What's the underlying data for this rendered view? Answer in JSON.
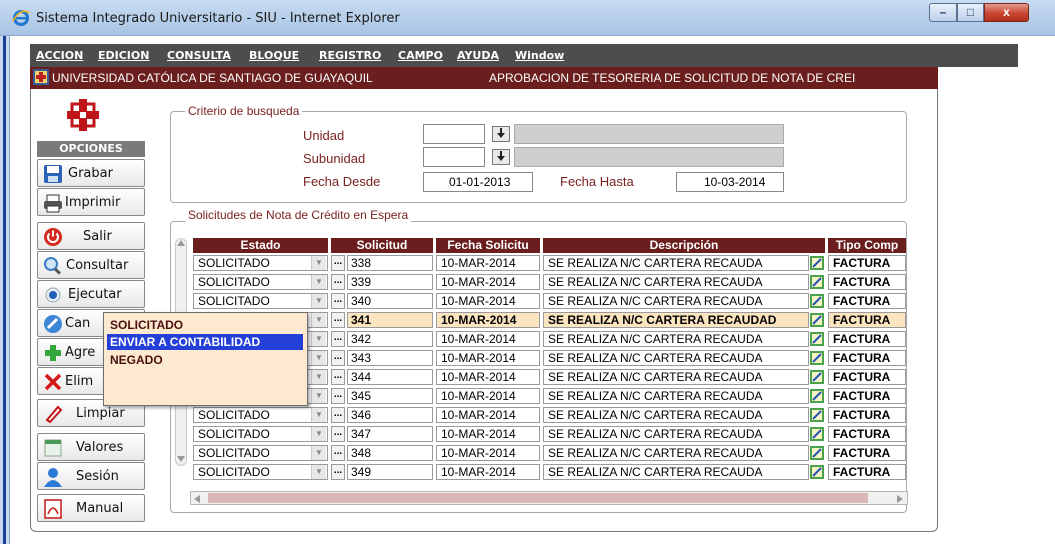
{
  "window": {
    "title": "Sistema Integrado Universitario - SIU - Internet Explorer",
    "minimize": "–",
    "maximize": "□",
    "close": "x"
  },
  "menu": [
    "ACCION",
    "EDICION",
    "CONSULTA",
    "BLOQUE",
    "REGISTRO",
    "CAMPO",
    "AYUDA",
    "Window"
  ],
  "header": {
    "university": "UNIVERSIDAD CATÓLICA DE SANTIAGO DE GUAYAQUIL",
    "process": "APROBACION DE TESORERIA DE SOLICITUD DE NOTA DE CREI"
  },
  "sidebar": {
    "title": "OPCIONES",
    "buttons": [
      "Grabar",
      "Imprimir",
      "Salir",
      "Consultar",
      "Ejecutar",
      "Can",
      "Agre",
      "Elim",
      "Limpiar",
      "Valores",
      "Sesión",
      "Manual"
    ]
  },
  "criterio": {
    "legend": "Criterio de busqueda",
    "unidad_label": "Unidad",
    "unidad_value": "",
    "subunidad_label": "Subunidad",
    "subunidad_value": "",
    "fecha_desde_label": "Fecha Desde",
    "fecha_desde": "01-01-2013",
    "fecha_hasta_label": "Fecha Hasta",
    "fecha_hasta": "10-03-2014"
  },
  "solicitudes": {
    "legend": "Solicitudes de Nota de Crédito en Espera",
    "columns": [
      "Estado",
      "Solicitud",
      "Fecha Solicitu",
      "Descripción",
      "Tipo Comp"
    ],
    "rows": [
      {
        "estado": "SOLICITADO",
        "solicitud": "338",
        "fecha": "10-MAR-2014",
        "descripcion": "SE REALIZA N/C CARTERA RECAUDA",
        "tipo": "FACTURA"
      },
      {
        "estado": "SOLICITADO",
        "solicitud": "339",
        "fecha": "10-MAR-2014",
        "descripcion": "SE REALIZA N/C CARTERA RECAUDA",
        "tipo": "FACTURA"
      },
      {
        "estado": "SOLICITADO",
        "solicitud": "340",
        "fecha": "10-MAR-2014",
        "descripcion": "SE REALIZA N/C CARTERA RECAUDA",
        "tipo": "FACTURA"
      },
      {
        "estado": "",
        "solicitud": "341",
        "fecha": "10-MAR-2014",
        "descripcion": "SE REALIZA N/C CARTERA RECAUDAD",
        "tipo": "FACTURA"
      },
      {
        "estado": "",
        "solicitud": "342",
        "fecha": "10-MAR-2014",
        "descripcion": "SE REALIZA N/C CARTERA RECAUDA",
        "tipo": "FACTURA"
      },
      {
        "estado": "",
        "solicitud": "343",
        "fecha": "10-MAR-2014",
        "descripcion": "SE REALIZA N/C CARTERA RECAUDA",
        "tipo": "FACTURA"
      },
      {
        "estado": "",
        "solicitud": "344",
        "fecha": "10-MAR-2014",
        "descripcion": "SE REALIZA N/C CARTERA RECAUDA",
        "tipo": "FACTURA"
      },
      {
        "estado": "",
        "solicitud": "345",
        "fecha": "10-MAR-2014",
        "descripcion": "SE REALIZA N/C CARTERA RECAUDA",
        "tipo": "FACTURA"
      },
      {
        "estado": "SOLICITADO",
        "solicitud": "346",
        "fecha": "10-MAR-2014",
        "descripcion": "SE REALIZA N/C CARTERA RECAUDA",
        "tipo": "FACTURA"
      },
      {
        "estado": "SOLICITADO",
        "solicitud": "347",
        "fecha": "10-MAR-2014",
        "descripcion": "SE REALIZA N/C CARTERA RECAUDA",
        "tipo": "FACTURA"
      },
      {
        "estado": "SOLICITADO",
        "solicitud": "348",
        "fecha": "10-MAR-2014",
        "descripcion": "SE REALIZA N/C CARTERA RECAUDA",
        "tipo": "FACTURA"
      },
      {
        "estado": "SOLICITADO",
        "solicitud": "349",
        "fecha": "10-MAR-2014",
        "descripcion": "SE REALIZA N/C CARTERA RECAUDA",
        "tipo": "FACTURA"
      }
    ],
    "row_button": "...",
    "dropdown_arrow": "▼"
  },
  "estado_dropdown": {
    "options": [
      "SOLICITADO",
      "ENVIAR A CONTABILIDAD",
      "NEGADO"
    ],
    "selected": "ENVIAR A CONTABILIDAD"
  },
  "colors": {
    "header_bg": "#6b1e1e",
    "menu_bg": "#4d4d4d",
    "selected_option": "#2540d8",
    "popup_bg": "#fde9cf"
  }
}
